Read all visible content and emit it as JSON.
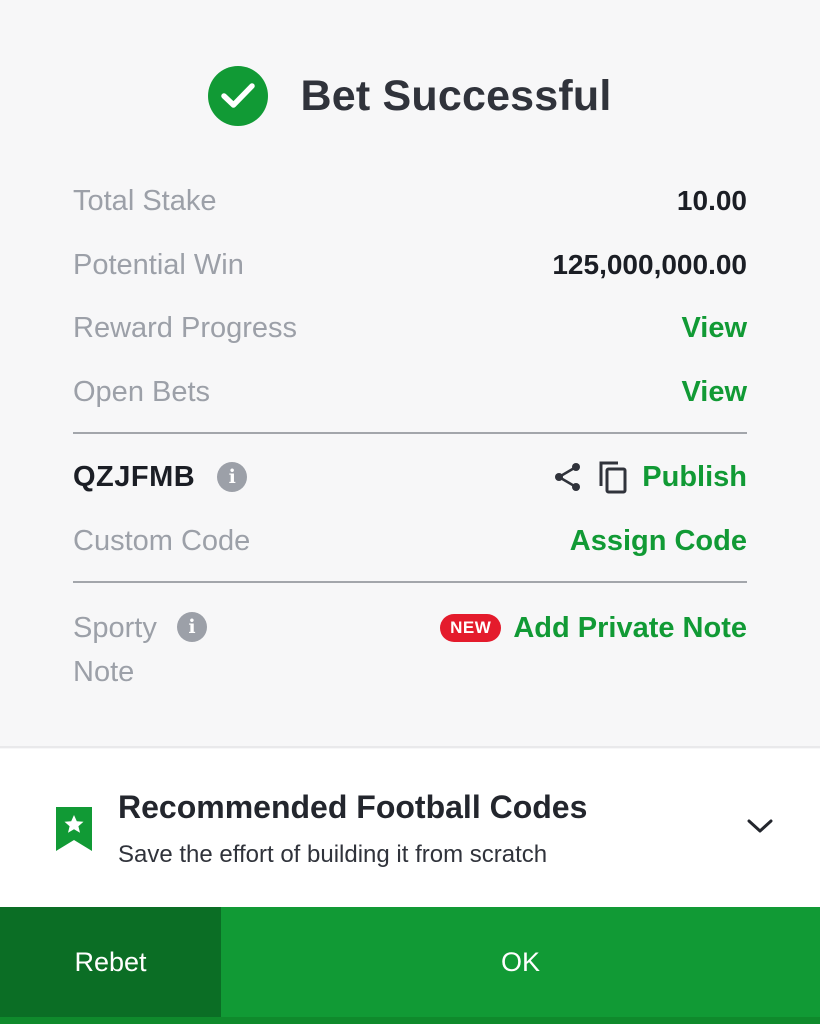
{
  "colors": {
    "accent": "#119a35",
    "rebet_bg": "#0b6e25",
    "new_badge": "#e41b2c"
  },
  "header": {
    "title": "Bet Successful",
    "icon": "check-circle-icon"
  },
  "summary": {
    "total_stake": {
      "label": "Total Stake",
      "value": "10.00"
    },
    "potential_win": {
      "label": "Potential Win",
      "value": "125,000,000.00"
    },
    "reward_progress": {
      "label": "Reward Progress",
      "link": "View"
    },
    "open_bets": {
      "label": "Open Bets",
      "link": "View"
    }
  },
  "booking": {
    "code": "QZJFMB",
    "info_icon": "info-icon",
    "share_icon": "share-icon",
    "copy_icon": "copy-icon",
    "publish": "Publish",
    "custom_code_label": "Custom Code",
    "assign_code": "Assign Code"
  },
  "note": {
    "label": "Sporty Note",
    "badge": "NEW",
    "link": "Add Private Note"
  },
  "recommended": {
    "icon": "bookmark-star-icon",
    "title": "Recommended Football Codes",
    "subtitle": "Save the effort of building it from scratch",
    "toggle_icon": "chevron-down-icon"
  },
  "footer": {
    "rebet": "Rebet",
    "ok": "OK"
  }
}
